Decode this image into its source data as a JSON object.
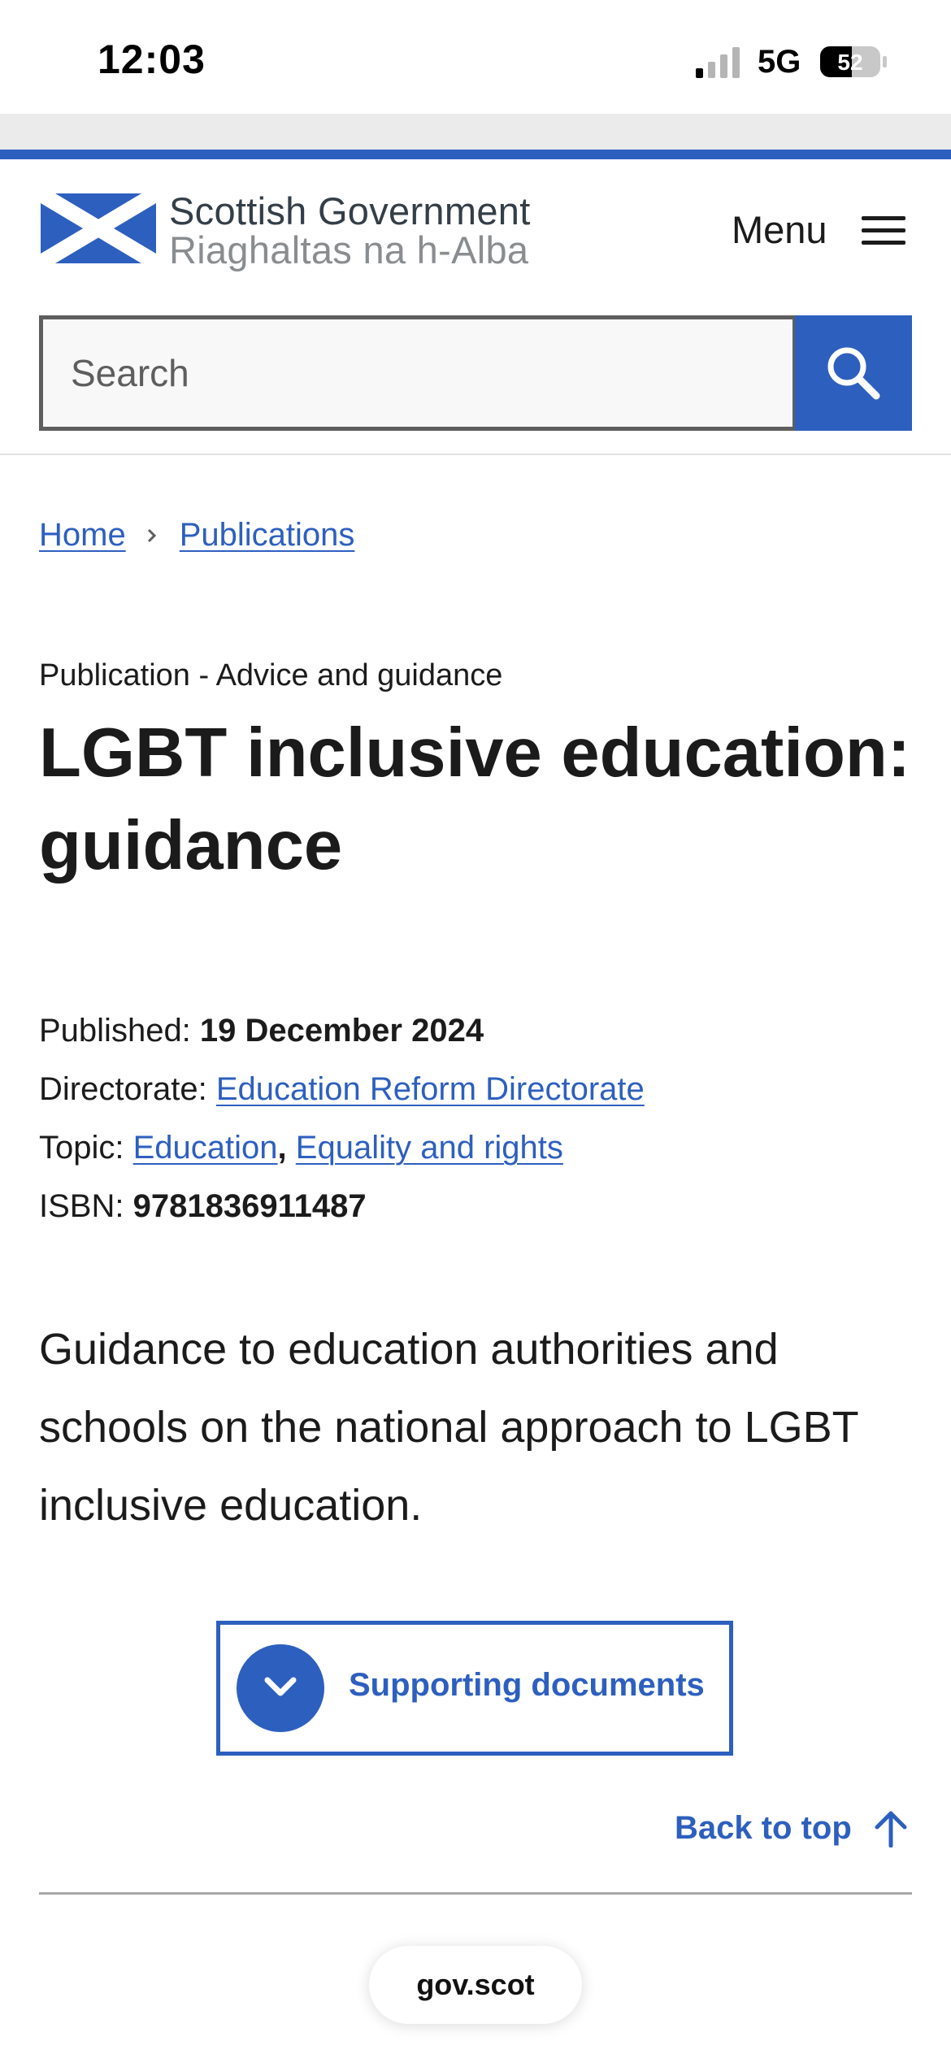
{
  "status_bar": {
    "time": "12:03",
    "network": "5G",
    "battery": "52"
  },
  "header": {
    "logo_english": "Scottish Government",
    "logo_gaelic": "Riaghaltas na h-Alba",
    "menu_label": "Menu"
  },
  "search": {
    "placeholder": "Search",
    "value": ""
  },
  "breadcrumb": {
    "items": [
      "Home",
      "Publications"
    ]
  },
  "publication": {
    "label": "Publication - Advice and guidance",
    "title": "LGBT inclusive education: guidance",
    "meta": {
      "published_label": "Published:",
      "published_value": "19 December 2024",
      "directorate_label": "Directorate:",
      "directorate_value": "Education Reform Directorate",
      "topic_label": "Topic:",
      "topics": [
        "Education",
        "Equality and rights"
      ],
      "topic_separator": ",",
      "isbn_label": "ISBN:",
      "isbn_value": "9781836911487"
    },
    "summary": "Guidance to education authorities and schools on the national approach to LGBT inclusive education."
  },
  "supporting_documents": {
    "label": "Supporting documents"
  },
  "back_to_top": {
    "label": "Back to top"
  },
  "browser": {
    "url": "gov.scot"
  },
  "colors": {
    "brand_blue": "#2d5fbf",
    "text": "#1b1b1b",
    "logo_grey": "#8a8d90"
  }
}
